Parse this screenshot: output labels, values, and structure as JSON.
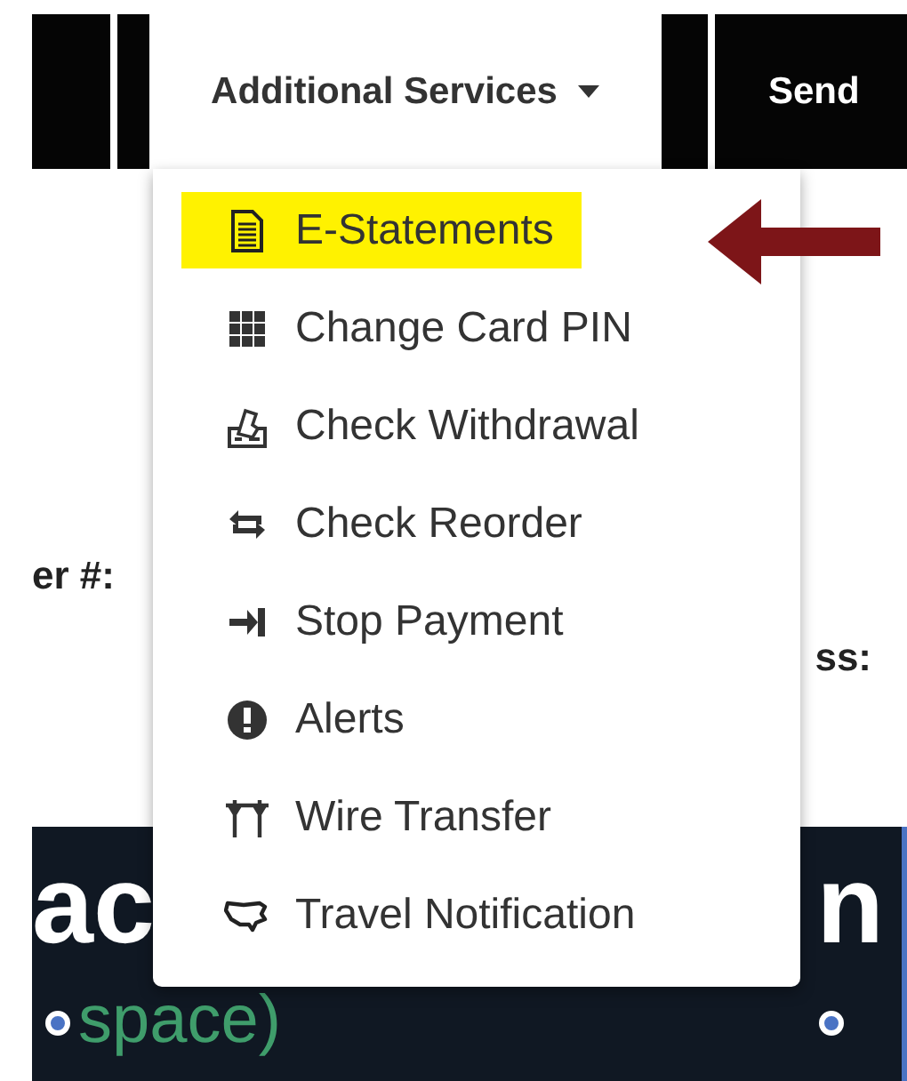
{
  "nav": {
    "items": [
      {
        "label": "Additional Services",
        "selected": true,
        "caret": true
      },
      {
        "label": "Send",
        "selected": false,
        "caret": false
      }
    ]
  },
  "menu": {
    "items": [
      {
        "label": "E-Statements",
        "kind": "document",
        "highlighted": true
      },
      {
        "label": "Change Card PIN",
        "kind": "keypad",
        "highlighted": false
      },
      {
        "label": "Check Withdrawal",
        "kind": "check",
        "highlighted": false
      },
      {
        "label": "Check Reorder",
        "kind": "reorder",
        "highlighted": false
      },
      {
        "label": "Stop Payment",
        "kind": "stop",
        "highlighted": false
      },
      {
        "label": "Alerts",
        "kind": "alert",
        "highlighted": false
      },
      {
        "label": "Wire Transfer",
        "kind": "wire",
        "highlighted": false
      },
      {
        "label": "Travel Notification",
        "kind": "map",
        "highlighted": false
      }
    ]
  },
  "details": {
    "label_1": "er #:",
    "label_2": "ss:"
  },
  "banner": {
    "heading_left": "ac",
    "heading_right": "n",
    "subtitle": "space)"
  }
}
